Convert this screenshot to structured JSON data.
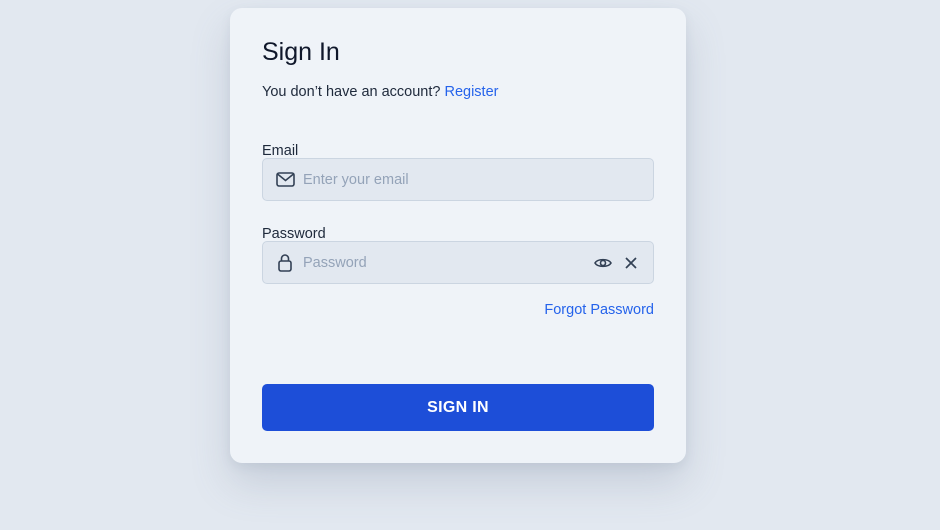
{
  "form": {
    "title": "Sign In",
    "subtitle_text": "You don’t have an account?",
    "register_link": "Register",
    "email_label": "Email",
    "email_placeholder": "Enter your email",
    "email_value": "",
    "password_label": "Password",
    "password_placeholder": "Password",
    "password_value": "",
    "forgot_link": "Forgot Password",
    "submit_label": "SIGN IN"
  },
  "icons": {
    "email": "mail-icon",
    "password": "lock-icon",
    "show_password": "eye-icon",
    "clear": "close-icon"
  },
  "colors": {
    "background": "#e2e8f0",
    "card": "#eff3f8",
    "accent": "#1d4ed8",
    "link": "#2563eb",
    "input_bg": "#e2e8f0"
  }
}
